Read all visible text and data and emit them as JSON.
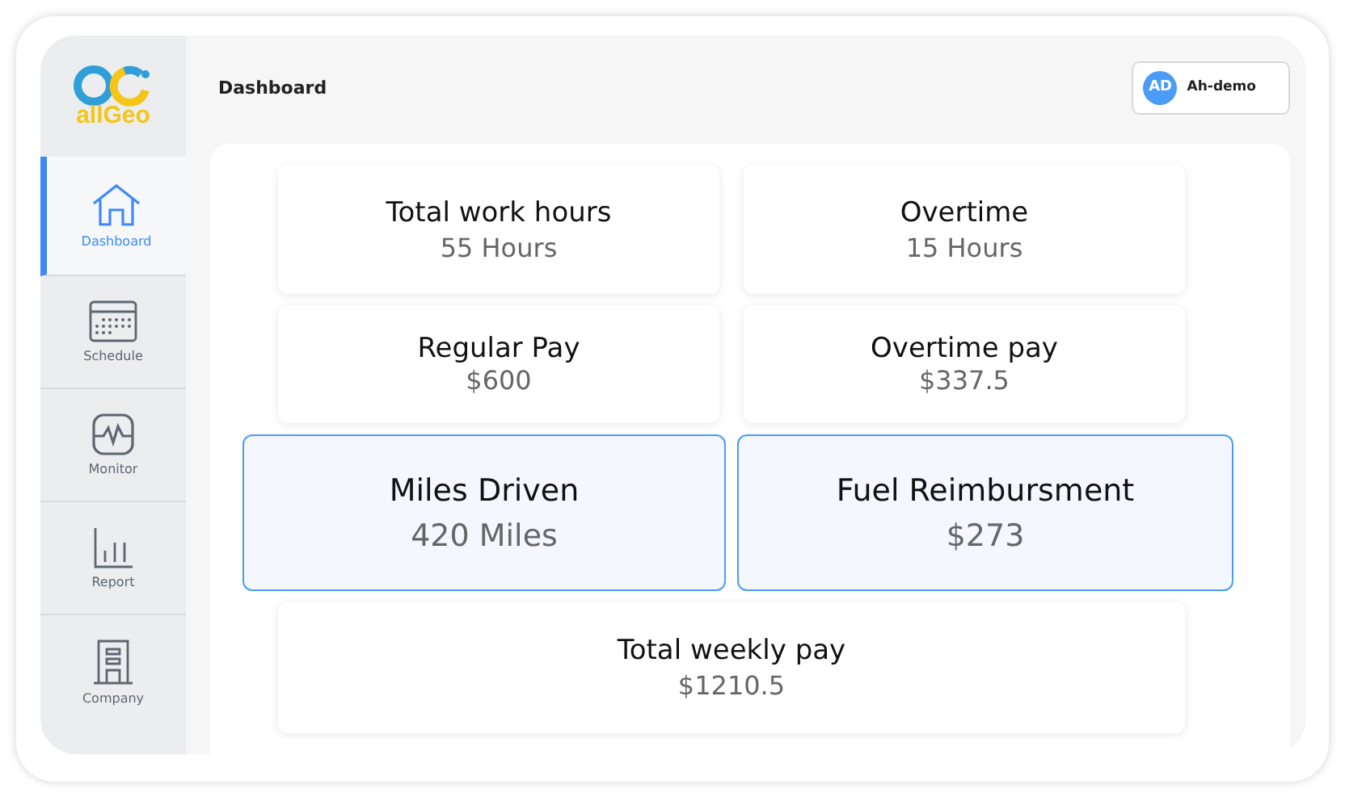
{
  "logo": {
    "text": "allGeo"
  },
  "nav": [
    {
      "label": "Dashboard",
      "selected": true
    },
    {
      "label": "Schedule",
      "selected": false
    },
    {
      "label": "Monitor",
      "selected": false
    },
    {
      "label": "Report",
      "selected": false
    },
    {
      "label": "Company",
      "selected": false
    }
  ],
  "header": {
    "title": "Dashboard",
    "user": {
      "initials": "AD",
      "name": "Ah-demo"
    }
  },
  "cards": [
    {
      "title": "Total work hours",
      "value": "55 Hours",
      "kind": "stat"
    },
    {
      "title": "Overtime",
      "value": "15 Hours",
      "kind": "stat"
    },
    {
      "title": "Regular Pay",
      "value": "$600",
      "kind": "stat"
    },
    {
      "title": "Overtime pay",
      "value": "$337.5",
      "kind": "stat"
    },
    {
      "title": "Miles Driven",
      "value": "420 Miles",
      "kind": "highlight"
    },
    {
      "title": "Fuel Reimbursment",
      "value": "$273",
      "kind": "highlight"
    },
    {
      "title": "Total weekly pay",
      "value": "$1210.5",
      "kind": "wide"
    }
  ]
}
